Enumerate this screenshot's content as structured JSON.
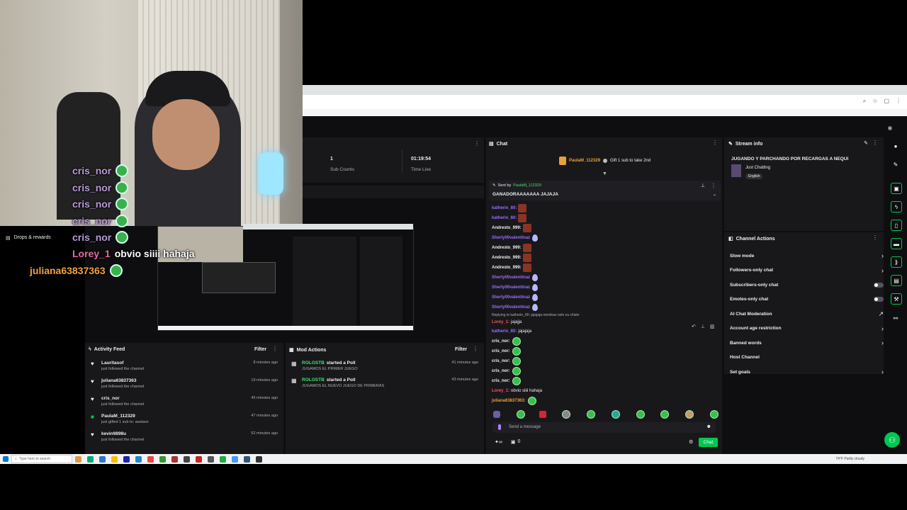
{
  "browser": {
    "icons": [
      "⌕",
      "☆",
      "▢",
      "⋮"
    ]
  },
  "stats": {
    "subs_value": "1",
    "subs_label": "Sub Counts",
    "time_value": "01:19:54",
    "time_label": "Time Live"
  },
  "sidebar": {
    "drops_label": "Drops & rewards"
  },
  "chat": {
    "title": "Chat",
    "gift_user": "PaulaM_112329",
    "gift_text": "Gift 1 sub to take 2nd",
    "pinned_by_label": "Sent by",
    "pinned_by_user": "PaulaM_112329",
    "pinned_text": "GANADORAAAAAAA JAJAJA",
    "lines": [
      {
        "user": "katherin_80:",
        "cls": "u-purple",
        "emote": "red"
      },
      {
        "user": "katherin_80:",
        "cls": "u-purple",
        "emote": "red"
      },
      {
        "user": "Andresto_999:",
        "cls": "u-white",
        "emote": "red"
      },
      {
        "user": "Sherly00valentinaz",
        "cls": "u-purple",
        "emote": "drop"
      },
      {
        "user": "Andresto_999:",
        "cls": "u-white",
        "emote": "red"
      },
      {
        "user": "Andresto_999:",
        "cls": "u-white",
        "emote": "red"
      },
      {
        "user": "Andresto_999:",
        "cls": "u-white",
        "emote": "red"
      },
      {
        "user": "Sherly00valentinaz",
        "cls": "u-purple",
        "emote": "drop"
      },
      {
        "user": "Sherly00valentinaz",
        "cls": "u-purple",
        "emote": "drop"
      },
      {
        "user": "Sherly00valentinaz",
        "cls": "u-purple",
        "emote": "drop"
      },
      {
        "user": "Sherly00valentinaz",
        "cls": "u-purple",
        "emote": "drop"
      }
    ],
    "reply_note": "Replying to katherin_80: jajajaja mentiras nolo es chiste",
    "reply_user": "Lorey_1:",
    "reply_text": "jajajja",
    "k_user": "katherin_80:",
    "k_text": "jajajaja",
    "cris_lines": [
      "cris_nor:",
      "cris_nor:",
      "cris_nor:",
      "cris_nor:",
      "cris_nor:"
    ],
    "lorey_user": "Lorey_1:",
    "lorey_text": "obvio siiii hahaja",
    "juliana_user": "juliana63837363:",
    "input_placeholder": "Send a message",
    "points": "0",
    "chat_button": "Chat"
  },
  "stream_info": {
    "title": "Stream info",
    "stream_title": "JUGANDO Y PARCHANDO POR RECARGAS A NEQUI",
    "category": "Just Chatting",
    "tag": "English"
  },
  "channel_actions": {
    "title": "Channel Actions",
    "items": [
      {
        "label": "Slow mode",
        "control": "chevron"
      },
      {
        "label": "Followers-only chat",
        "control": "chevron"
      },
      {
        "label": "Subscribers-only chat",
        "control": "toggle"
      },
      {
        "label": "Emotes-only chat",
        "control": "toggle"
      },
      {
        "label": "AI Chat Moderation",
        "control": "external"
      },
      {
        "label": "Account age restriction",
        "control": "chevron"
      },
      {
        "label": "Banned words",
        "control": "chevron"
      },
      {
        "label": "Host Channel",
        "control": "none"
      },
      {
        "label": "Set goals",
        "control": "chevron"
      }
    ]
  },
  "activity_feed": {
    "title": "Activity Feed",
    "filter": "Filter",
    "items": [
      {
        "name": "Lauritasof",
        "sub": "just followed the channel",
        "time": "8 minutes ago",
        "icon": "♥"
      },
      {
        "name": "juliana63837363",
        "sub": "just followed the channel",
        "time": "19 minutes ago",
        "icon": "♥"
      },
      {
        "name": "cris_nor",
        "sub": "just followed the channel",
        "time": "45 minutes ago",
        "icon": "♥"
      },
      {
        "name": "PaulaM_112329",
        "sub": "just gifted 1 sub to: asstave",
        "time": "47 minutes ago",
        "icon": "■"
      },
      {
        "name": "kevin9898u",
        "sub": "just followed the channel",
        "time": "52 minutes ago",
        "icon": "♥"
      }
    ]
  },
  "mod_actions": {
    "title": "Mod Actions",
    "filter": "Filter",
    "items": [
      {
        "name": "ROLOSTB",
        "action": "started a Poll",
        "sub": "JUGAMOS EL PRIMER JUEGO",
        "time": "41 minutes ago"
      },
      {
        "name": "ROLOSTB",
        "action": "started a Poll",
        "sub": "JUGAMOS EL NUEVO JUEGO DE PRIMERAS",
        "time": "43 minutes ago"
      }
    ]
  },
  "overlay": {
    "lines": [
      {
        "user": "cris_nor",
        "text": "",
        "color": "#b99bd9"
      },
      {
        "user": "cris_nor",
        "text": "",
        "color": "#b99bd9"
      },
      {
        "user": "cris_nor",
        "text": "",
        "color": "#b99bd9"
      },
      {
        "user": "cris_nor",
        "text": "",
        "color": "#b99bd9"
      },
      {
        "user": "cris_nor",
        "text": "",
        "color": "#b99bd9"
      },
      {
        "user": "Lorey_1",
        "text": "obvio siiii hahaja",
        "color": "#e36ba0"
      },
      {
        "user": "juliana63837363",
        "text": "",
        "color": "#f0a23c"
      }
    ]
  },
  "taskbar": {
    "search": "Type here to search",
    "weather": "74°F Partly cloudy"
  }
}
